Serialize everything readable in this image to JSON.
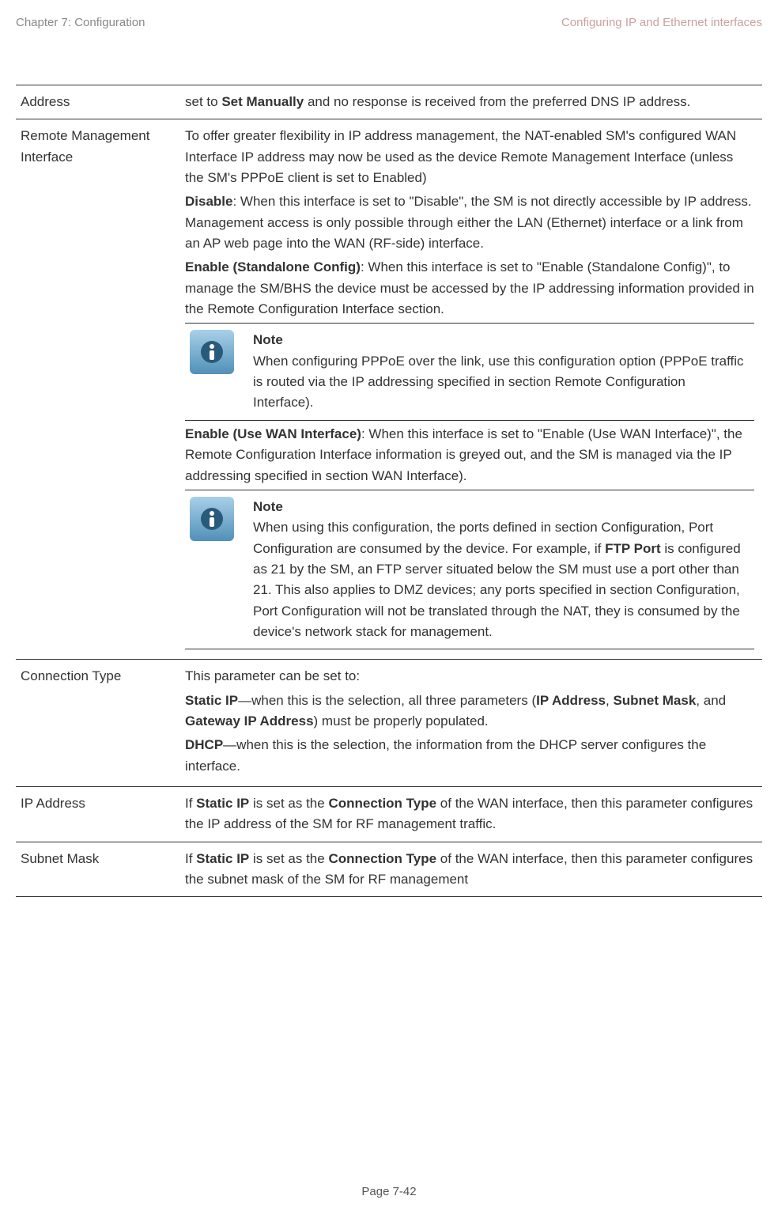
{
  "header": {
    "left": "Chapter 7:  Configuration",
    "right": "Configuring IP and Ethernet interfaces"
  },
  "rows": {
    "address": {
      "label": "Address",
      "pre": "set to ",
      "setManually": "Set Manually",
      "post": " and no response is received from the preferred DNS IP address."
    },
    "rmi": {
      "label": "Remote Management Interface",
      "p1": "To offer greater flexibility in IP address management, the NAT-enabled SM's configured WAN Interface IP address may now be used as the device Remote Management Interface (unless the SM's PPPoE client is set to Enabled)",
      "disableB": "Disable",
      "disable": ": When this interface is set to \"Disable\", the SM is not directly accessible by IP address. Management access is only possible through either the LAN (Ethernet) interface or a link from an AP web page into the WAN (RF-side) interface.",
      "enableSB": "Enable (Standalone Config)",
      "enableS": ": When this interface is set to \"Enable (Standalone Config)\", to manage the SM/BHS the device must be accessed by the IP addressing information provided in the Remote Configuration Interface section.",
      "note1Title": "Note",
      "note1Body": "When configuring PPPoE over the link, use this configuration option (PPPoE traffic is routed via the IP addressing specified in section Remote Configuration Interface).",
      "enableWB": "Enable (Use WAN Interface)",
      "enableW": ":  When this interface is set to \"Enable (Use WAN Interface)\", the Remote Configuration Interface information is greyed out, and the SM is managed via the IP addressing specified in section WAN Interface).",
      "note2Title": "Note",
      "note2Pre": "When using this configuration, the ports defined in section Configuration, Port Configuration are consumed by the device.  For example, if ",
      "ftpPort": "FTP Port",
      "note2Post": " is configured as 21 by the SM, an FTP server situated below the SM must use a port other than 21. This also applies to DMZ devices; any ports specified in section Configuration, Port Configuration will not be translated through the NAT, they is consumed by the device's network stack for management."
    },
    "conn": {
      "label": "Connection Type",
      "intro": "This parameter can be set to:",
      "staticB": "Static IP",
      "staticMid1": "—when this is the selection, all three parameters (",
      "ipAddr": "IP Address",
      "comma": ", ",
      "subnet": "Subnet Mask",
      "and": ", and ",
      "gateway": "Gateway IP Address",
      "staticEnd": ") must be properly populated.",
      "dhcpB": "DHCP",
      "dhcp": "—when this is the selection, the information from the DHCP server configures the interface."
    },
    "ip": {
      "label": "IP Address",
      "pre": "If ",
      "static": "Static IP",
      "mid": " is set as the ",
      "ct": "Connection Type",
      "post": " of the WAN interface, then this parameter configures the IP address of the SM for RF management traffic."
    },
    "sm": {
      "label": "Subnet Mask",
      "pre": "If ",
      "static": "Static IP",
      "mid": " is set as the ",
      "ct": "Connection Type",
      "post": " of the WAN interface, then this parameter configures the subnet mask of the SM for RF management"
    }
  },
  "footer": "Page 7-42"
}
